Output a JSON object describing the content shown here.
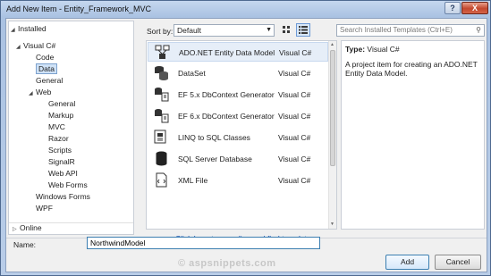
{
  "window": {
    "title": "Add New Item - Entity_Framework_MVC",
    "help_label": "?",
    "close_label": "X"
  },
  "tree": {
    "installed": "Installed",
    "visual_csharp": "Visual C#",
    "code": "Code",
    "data": "Data",
    "general": "General",
    "web": "Web",
    "web_children": [
      "General",
      "Markup",
      "MVC",
      "Razor",
      "Scripts",
      "SignalR",
      "Web API",
      "Web Forms"
    ],
    "windows_forms": "Windows Forms",
    "wpf": "WPF",
    "online": "Online"
  },
  "toolbar": {
    "sort_by_label": "Sort by:",
    "sort_by_value": "Default",
    "search_placeholder": "Search Installed Templates (Ctrl+E)"
  },
  "templates": [
    {
      "name": "ADO.NET Entity Data Model",
      "language": "Visual C#",
      "icon": "entity-model-icon"
    },
    {
      "name": "DataSet",
      "language": "Visual C#",
      "icon": "dataset-icon"
    },
    {
      "name": "EF 5.x DbContext Generator",
      "language": "Visual C#",
      "icon": "dbcontext-generator-icon"
    },
    {
      "name": "EF 6.x DbContext Generator",
      "language": "Visual C#",
      "icon": "dbcontext-generator-icon"
    },
    {
      "name": "LINQ to SQL Classes",
      "language": "Visual C#",
      "icon": "linq-to-sql-icon"
    },
    {
      "name": "SQL Server Database",
      "language": "Visual C#",
      "icon": "database-icon"
    },
    {
      "name": "XML File",
      "language": "Visual C#",
      "icon": "xml-file-icon"
    }
  ],
  "online_link": "Click here to go online and find templates.",
  "description": {
    "type_label": "Type:",
    "type_value": "Visual C#",
    "text": "A project item for creating an ADO.NET Entity Data Model."
  },
  "footer": {
    "name_label": "Name:",
    "name_value": "NorthwindModel",
    "add_label": "Add",
    "cancel_label": "Cancel",
    "watermark": "© aspsnippets.com"
  },
  "colors": {
    "selection": "#cfe2f7",
    "link": "#0645ad",
    "accent_border": "#3c7fb1"
  }
}
